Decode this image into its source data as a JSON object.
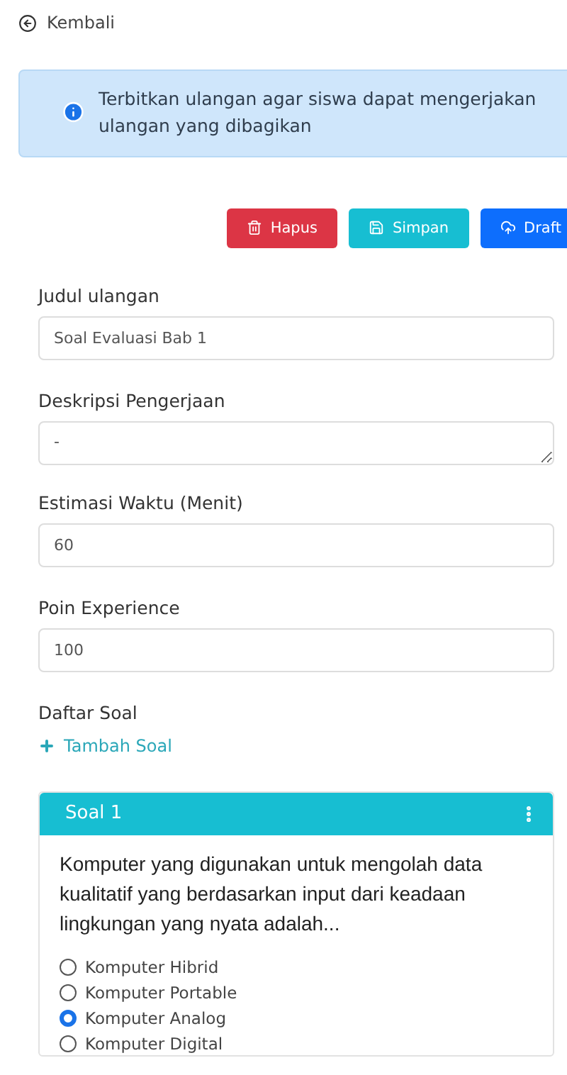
{
  "back_link": {
    "label": "Kembali"
  },
  "alert": {
    "text": "Terbitkan ulangan agar siswa dapat mengerjakan ulangan yang dibagikan"
  },
  "actions": [
    {
      "label": "Hapus",
      "kind": "danger"
    },
    {
      "label": "Simpan",
      "kind": "save"
    },
    {
      "label": "Draft",
      "kind": "draft"
    }
  ],
  "fields": [
    {
      "label": "Judul ulangan",
      "value": "Soal Evaluasi Bab 1",
      "kind": "input"
    },
    {
      "label": "Deskripsi Pengerjaan",
      "value": "-",
      "kind": "textarea"
    },
    {
      "label": "Estimasi Waktu (Menit)",
      "value": "60",
      "kind": "input"
    },
    {
      "label": "Poin Experience",
      "value": "100",
      "kind": "input"
    }
  ],
  "questions_section": {
    "title": "Daftar Soal",
    "add_label": "Tambah Soal"
  },
  "question_card": {
    "title": "Soal 1",
    "question": "Komputer yang digunakan untuk mengolah data kualitatif yang berdasarkan input dari keadaan lingkungan yang nyata adalah...",
    "options": [
      {
        "label": "Komputer Hibrid",
        "selected": false
      },
      {
        "label": "Komputer Portable",
        "selected": false
      },
      {
        "label": "Komputer Analog",
        "selected": true
      },
      {
        "label": "Komputer Digital",
        "selected": false
      }
    ]
  }
}
